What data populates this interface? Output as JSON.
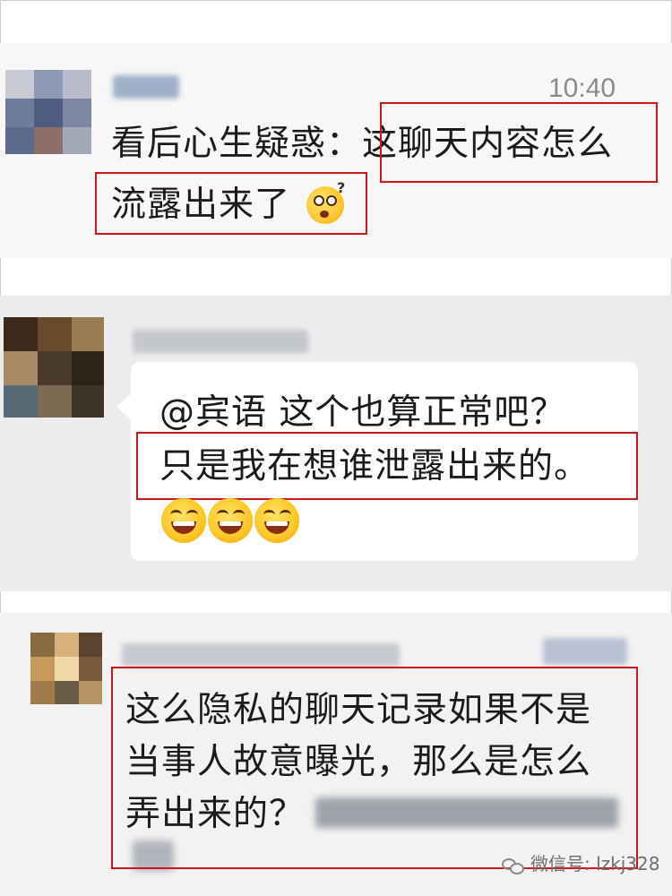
{
  "messages": [
    {
      "timestamp": "10:40",
      "lines": [
        "看后心生疑惑：这聊天内容怎么",
        "流露出来了"
      ],
      "line_parts": {
        "prefix": "看后心生疑惑：",
        "highlight": "这聊天内容怎么",
        "line2": "流露出来了"
      },
      "emoji": "confused-face-icon"
    },
    {
      "lines": [
        "@宾语  这个也算正常吧？",
        "只是我在想谁泄露出来的。"
      ],
      "emojis": [
        "grinning-face-icon",
        "grinning-face-icon",
        "grinning-face-icon"
      ]
    },
    {
      "lines": [
        "这么隐私的聊天记录如果不是",
        "当事人故意曝光，那么是怎么",
        "弄出来的？"
      ]
    }
  ],
  "watermark": {
    "text": "微信号: lzkj328",
    "icon": "wechat-icon"
  },
  "colors": {
    "highlight_border": "#d0161c",
    "text": "#1b1b1b",
    "timestamp": "#8a8a8a"
  }
}
